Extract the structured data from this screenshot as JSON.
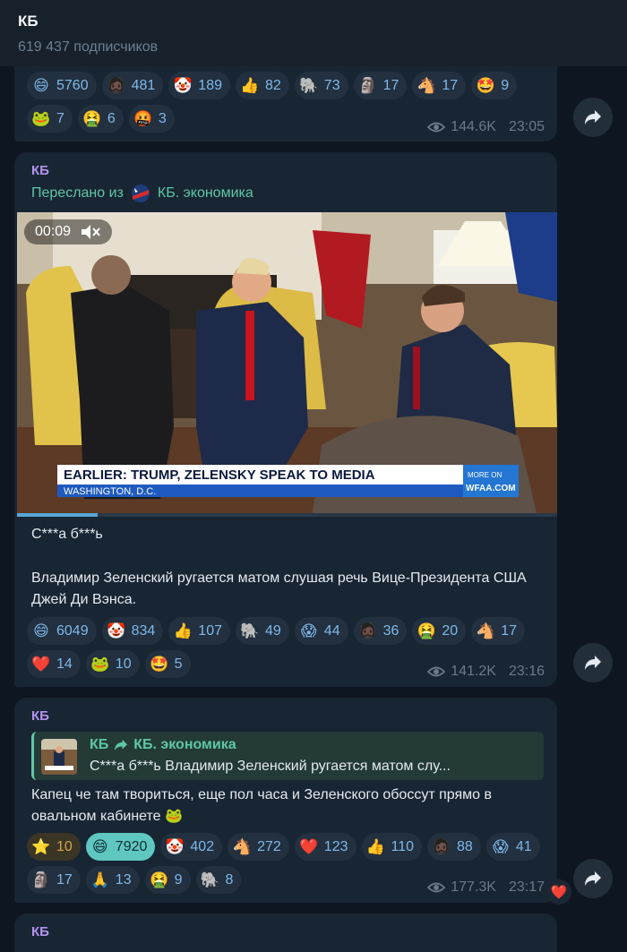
{
  "header": {
    "title": "КБ",
    "subscribers": "619 437 подписчиков"
  },
  "post1": {
    "reactions": [
      {
        "emoji": "😄",
        "count": "5760"
      },
      {
        "emoji": "🧔🏿",
        "count": "481"
      },
      {
        "emoji": "🤡",
        "count": "189"
      },
      {
        "emoji": "👍",
        "count": "82"
      },
      {
        "emoji": "🐘",
        "count": "73"
      },
      {
        "emoji": "🗿",
        "count": "17"
      },
      {
        "emoji": "🐴",
        "count": "17"
      },
      {
        "emoji": "🤩",
        "count": "9"
      },
      {
        "emoji": "🐸",
        "count": "7"
      },
      {
        "emoji": "🤮",
        "count": "6"
      },
      {
        "emoji": "🤬",
        "count": "3"
      }
    ],
    "views": "144.6K",
    "time": "23:05"
  },
  "post2": {
    "channel": "КБ",
    "forwarded_prefix": "Переслано из",
    "forwarded_from": "КБ. экономика",
    "video_time": "00:09",
    "video_caption": {
      "headline": "EARLIER: TRUMP, ZELENSKY SPEAK TO MEDIA",
      "location": "WASHINGTON, D.C.",
      "brand_top": "MORE ON",
      "brand": "WFAA.COM"
    },
    "text_line1": "С***а б***ь",
    "text_line2": "Владимир Зеленский ругается матом слушая речь Вице-Президента США Джей Ди Вэнса.",
    "reactions": [
      {
        "emoji": "😄",
        "count": "6049"
      },
      {
        "emoji": "🤡",
        "count": "834"
      },
      {
        "emoji": "👍",
        "count": "107"
      },
      {
        "emoji": "🐘",
        "count": "49"
      },
      {
        "emoji": "😱",
        "count": "44"
      },
      {
        "emoji": "🧔🏿",
        "count": "36"
      },
      {
        "emoji": "🤮",
        "count": "20"
      },
      {
        "emoji": "🐴",
        "count": "17"
      },
      {
        "emoji": "❤️",
        "count": "14"
      },
      {
        "emoji": "🐸",
        "count": "10"
      },
      {
        "emoji": "🤩",
        "count": "5"
      }
    ],
    "views": "141.2K",
    "time": "23:16"
  },
  "post3": {
    "channel": "КБ",
    "quote_source": "КБ",
    "quote_target": "КБ. экономика",
    "quote_text": "С***а б***ь  Владимир Зеленский ругается матом слу...",
    "text": "Капец че там твориться, еще пол часа и Зеленского обоссут прямо в овальном кабинете 🐸",
    "reactions": [
      {
        "emoji": "⭐",
        "count": "10",
        "style": "gold"
      },
      {
        "emoji": "😄",
        "count": "7920",
        "style": "active"
      },
      {
        "emoji": "🤡",
        "count": "402"
      },
      {
        "emoji": "🐴",
        "count": "272"
      },
      {
        "emoji": "❤️",
        "count": "123"
      },
      {
        "emoji": "👍",
        "count": "110"
      },
      {
        "emoji": "🧔🏿",
        "count": "88"
      },
      {
        "emoji": "😱",
        "count": "41"
      },
      {
        "emoji": "🗿",
        "count": "17"
      },
      {
        "emoji": "🙏",
        "count": "13"
      },
      {
        "emoji": "🤮",
        "count": "9"
      },
      {
        "emoji": "🐘",
        "count": "8"
      }
    ],
    "views": "177.3K",
    "time": "23:17",
    "own_reaction": "❤️"
  },
  "post4": {
    "channel": "КБ"
  },
  "colors": {
    "background": "#0e1621",
    "bubble": "#182533",
    "accent": "#5fc7a7",
    "channel_name": "#b393ee",
    "reaction_text": "#7fb8ea"
  }
}
